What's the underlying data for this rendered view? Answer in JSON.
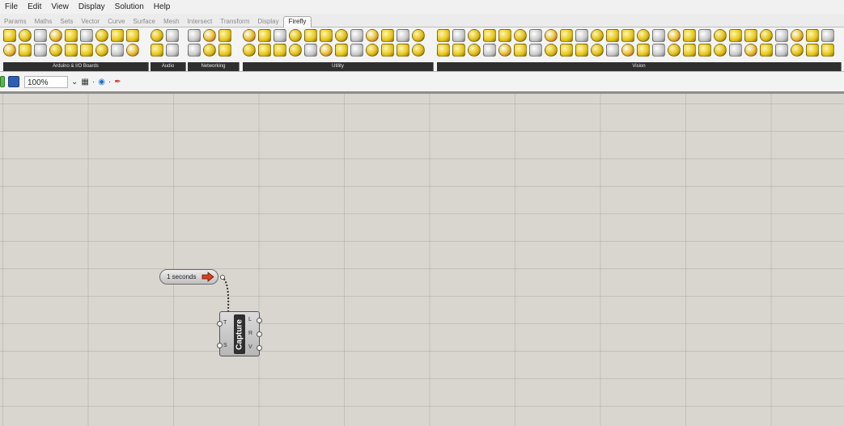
{
  "menu": [
    "File",
    "Edit",
    "View",
    "Display",
    "Solution",
    "Help"
  ],
  "tabs": [
    {
      "label": "Params",
      "active": false
    },
    {
      "label": "Maths",
      "active": false
    },
    {
      "label": "Sets",
      "active": false
    },
    {
      "label": "Vector",
      "active": false
    },
    {
      "label": "Curve",
      "active": false
    },
    {
      "label": "Surface",
      "active": false
    },
    {
      "label": "Mesh",
      "active": false
    },
    {
      "label": "Intersect",
      "active": false
    },
    {
      "label": "Transform",
      "active": false
    },
    {
      "label": "Display",
      "active": false
    },
    {
      "label": "Firefly",
      "active": true
    }
  ],
  "ribbon_groups": [
    {
      "label": "Arduino & I/O Boards"
    },
    {
      "label": "Audio"
    },
    {
      "label": "Networking"
    },
    {
      "label": "Utility"
    },
    {
      "label": "Vision"
    }
  ],
  "toolbar": {
    "zoom": "100%"
  },
  "timer": {
    "label": "1 seconds"
  },
  "capture": {
    "title": "Capture",
    "inputs": [
      "T",
      "S"
    ],
    "outputs": [
      "L",
      "R",
      "V"
    ]
  },
  "colors": {
    "accent_active_tab": "#fbfbfb",
    "canvas": "#d9d6d0",
    "timer_arrow": "#d8401e"
  }
}
